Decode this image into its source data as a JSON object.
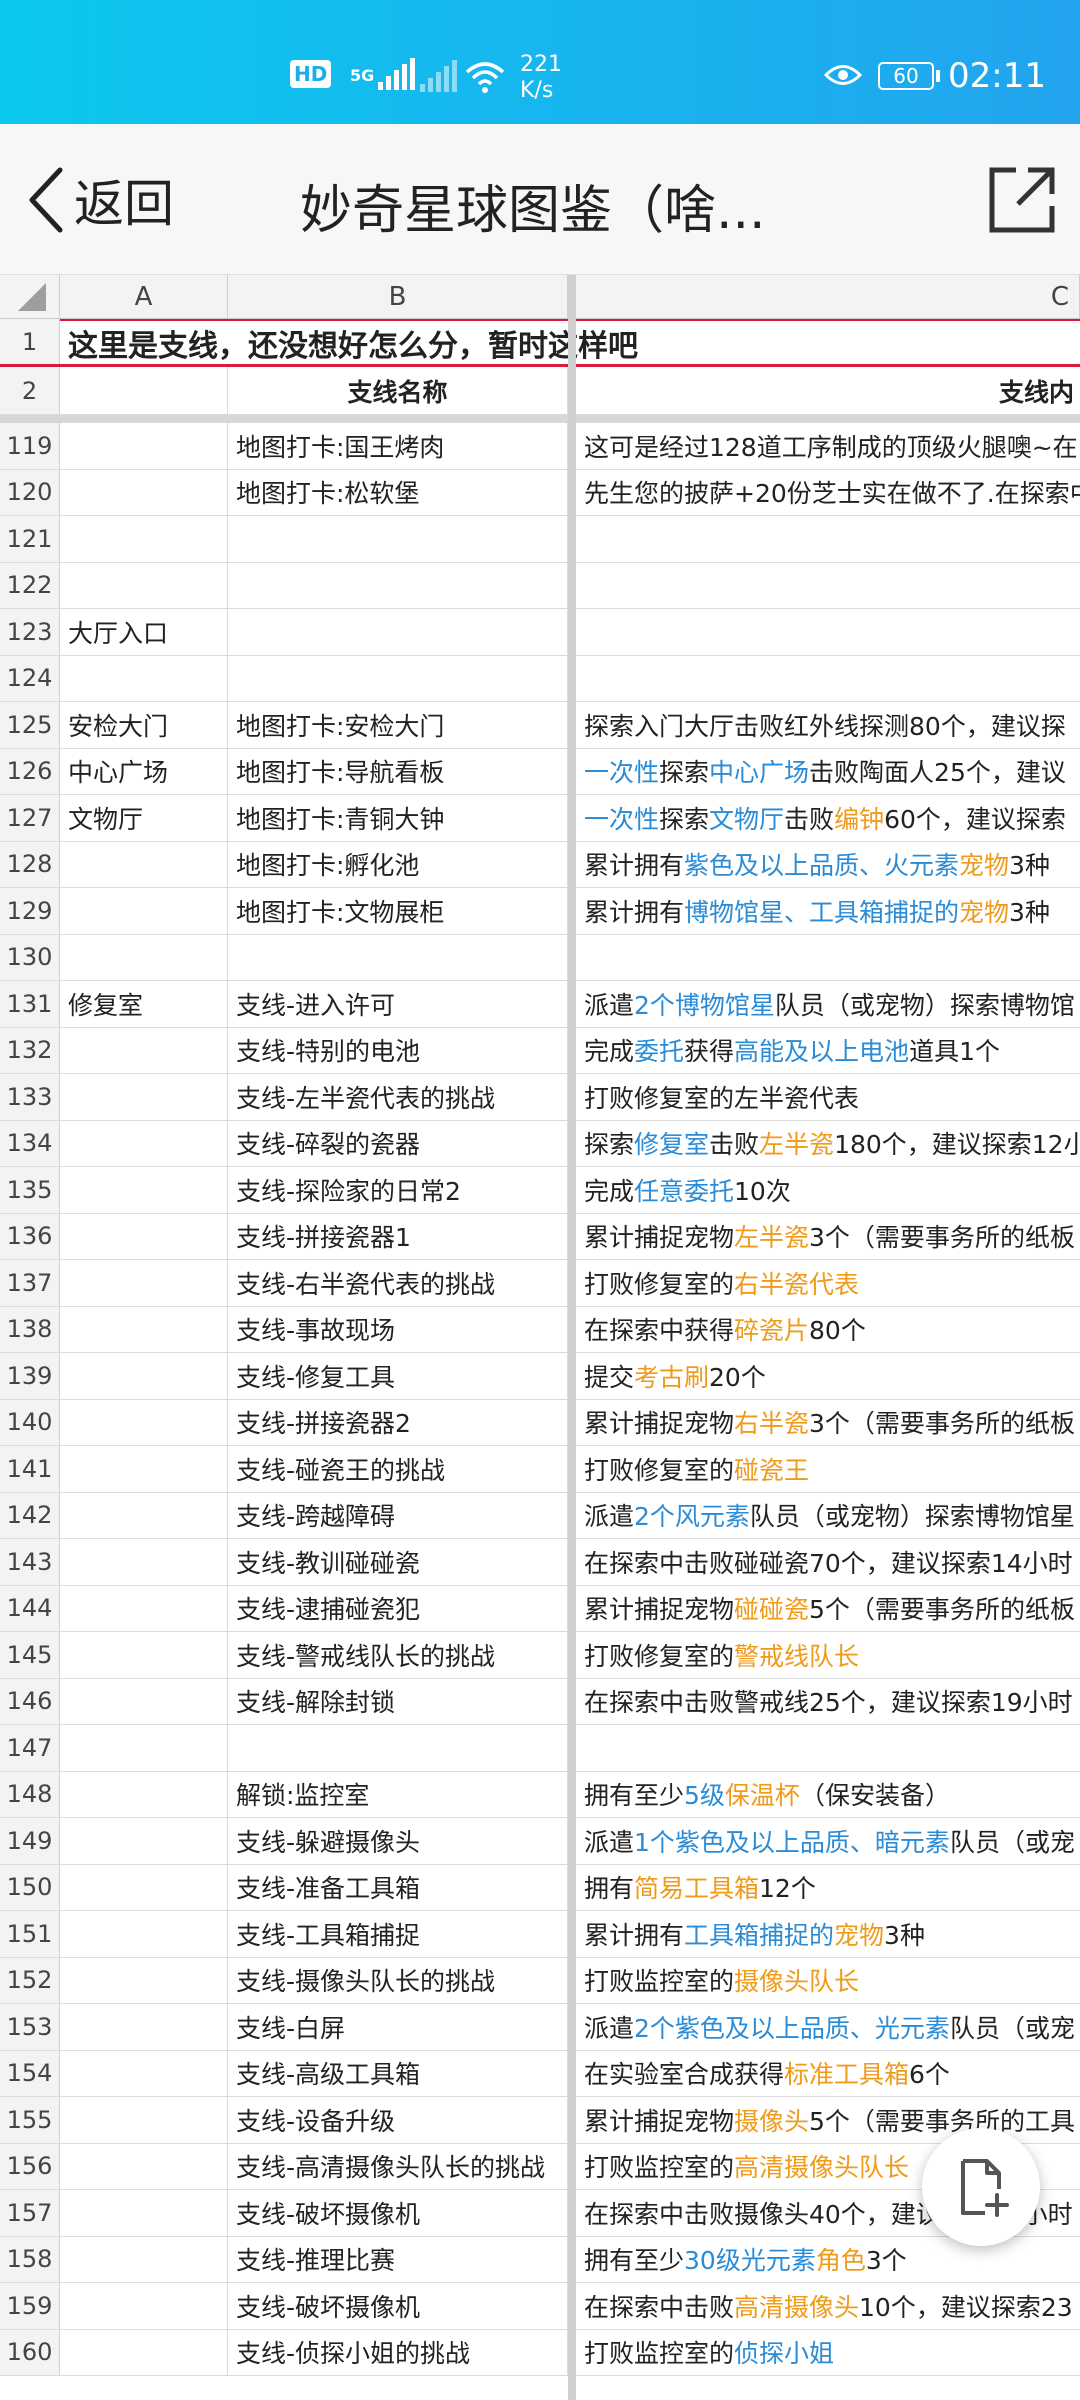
{
  "status": {
    "network_badge": "HD",
    "signal_label": "5G",
    "speed_value": "221",
    "speed_unit": "K/s",
    "battery": "60",
    "time": "02:11"
  },
  "appbar": {
    "back_label": "返回",
    "title": "妙奇星球图鉴（啥..."
  },
  "sheet": {
    "col_headers": [
      "A",
      "B",
      "C"
    ],
    "row1": {
      "num": "1",
      "text": "这里是支线，还没想好怎么分，暂时这样吧"
    },
    "row2": {
      "num": "2",
      "b": "支线名称",
      "c": "支线内"
    },
    "rows": [
      {
        "n": "119",
        "a": "",
        "b": "地图打卡:国王烤肉",
        "c": [
          {
            "t": "这可是经过128道工序制成的顶级火腿噢~在"
          }
        ]
      },
      {
        "n": "120",
        "a": "",
        "b": "地图打卡:松软堡",
        "c": [
          {
            "t": "先生您的披萨+20份芝士实在做不了.在探索中"
          }
        ]
      },
      {
        "n": "121",
        "a": "",
        "b": "",
        "c": []
      },
      {
        "n": "122",
        "a": "",
        "b": "",
        "c": []
      },
      {
        "n": "123",
        "a": "大厅入口",
        "b": "",
        "c": []
      },
      {
        "n": "124",
        "a": "",
        "b": "",
        "c": []
      },
      {
        "n": "125",
        "a": "安检大门",
        "b": "地图打卡:安检大门",
        "c": [
          {
            "t": "探索入门大厅击败红外线探测80个，建议探"
          }
        ]
      },
      {
        "n": "126",
        "a": "中心广场",
        "b": "地图打卡:导航看板",
        "c": [
          {
            "t": "一次性",
            "k": "blue"
          },
          {
            "t": "探索"
          },
          {
            "t": "中心广场",
            "k": "blue"
          },
          {
            "t": "击败陶面人25个，建议"
          }
        ]
      },
      {
        "n": "127",
        "a": "文物厅",
        "b": "地图打卡:青铜大钟",
        "c": [
          {
            "t": "一次性",
            "k": "blue"
          },
          {
            "t": "探索"
          },
          {
            "t": "文物厅",
            "k": "blue"
          },
          {
            "t": "击败"
          },
          {
            "t": "编钟",
            "k": "orange"
          },
          {
            "t": "60个，建议探索"
          }
        ]
      },
      {
        "n": "128",
        "a": "",
        "b": "地图打卡:孵化池",
        "c": [
          {
            "t": "累计拥有"
          },
          {
            "t": "紫色及以上品质、火元素",
            "k": "blue"
          },
          {
            "t": "宠物",
            "k": "orange"
          },
          {
            "t": "3种"
          }
        ]
      },
      {
        "n": "129",
        "a": "",
        "b": "地图打卡:文物展柜",
        "c": [
          {
            "t": "累计拥有"
          },
          {
            "t": "博物馆星、工具箱捕捉的",
            "k": "blue"
          },
          {
            "t": "宠物",
            "k": "orange"
          },
          {
            "t": "3种"
          }
        ]
      },
      {
        "n": "130",
        "a": "",
        "b": "",
        "c": []
      },
      {
        "n": "131",
        "a": "修复室",
        "b": "支线-进入许可",
        "c": [
          {
            "t": "派遣"
          },
          {
            "t": "2个博物馆星",
            "k": "blue"
          },
          {
            "t": "队员（或宠物）探索博物馆"
          }
        ]
      },
      {
        "n": "132",
        "a": "",
        "b": "支线-特别的电池",
        "c": [
          {
            "t": "完成"
          },
          {
            "t": "委托",
            "k": "blue"
          },
          {
            "t": "获得"
          },
          {
            "t": "高能及以上电池",
            "k": "blue"
          },
          {
            "t": "道具1个"
          }
        ]
      },
      {
        "n": "133",
        "a": "",
        "b": "支线-左半瓷代表的挑战",
        "c": [
          {
            "t": "打败修复室的左半瓷代表"
          }
        ]
      },
      {
        "n": "134",
        "a": "",
        "b": "支线-碎裂的瓷器",
        "c": [
          {
            "t": "探索"
          },
          {
            "t": "修复室",
            "k": "blue"
          },
          {
            "t": "击败"
          },
          {
            "t": "左半瓷",
            "k": "orange"
          },
          {
            "t": "180个，建议探索12小"
          }
        ]
      },
      {
        "n": "135",
        "a": "",
        "b": "支线-探险家的日常2",
        "c": [
          {
            "t": "完成"
          },
          {
            "t": "任意委托",
            "k": "blue"
          },
          {
            "t": "10次"
          }
        ]
      },
      {
        "n": "136",
        "a": "",
        "b": "支线-拼接瓷器1",
        "c": [
          {
            "t": "累计捕捉宠物"
          },
          {
            "t": "左半瓷",
            "k": "orange"
          },
          {
            "t": "3个（需要事务所的纸板"
          }
        ]
      },
      {
        "n": "137",
        "a": "",
        "b": "支线-右半瓷代表的挑战",
        "c": [
          {
            "t": "打败修复室的"
          },
          {
            "t": "右半瓷代表",
            "k": "orange"
          }
        ]
      },
      {
        "n": "138",
        "a": "",
        "b": "支线-事故现场",
        "c": [
          {
            "t": "在探索中获得"
          },
          {
            "t": "碎瓷片",
            "k": "orange"
          },
          {
            "t": "80个"
          }
        ]
      },
      {
        "n": "139",
        "a": "",
        "b": "支线-修复工具",
        "c": [
          {
            "t": "提交"
          },
          {
            "t": "考古刷",
            "k": "orange"
          },
          {
            "t": "20个"
          }
        ]
      },
      {
        "n": "140",
        "a": "",
        "b": "支线-拼接瓷器2",
        "c": [
          {
            "t": "累计捕捉宠物"
          },
          {
            "t": "右半瓷",
            "k": "orange"
          },
          {
            "t": "3个（需要事务所的纸板"
          }
        ]
      },
      {
        "n": "141",
        "a": "",
        "b": "支线-碰瓷王的挑战",
        "c": [
          {
            "t": "打败修复室的"
          },
          {
            "t": "碰瓷王",
            "k": "orange"
          }
        ]
      },
      {
        "n": "142",
        "a": "",
        "b": "支线-跨越障碍",
        "c": [
          {
            "t": "派遣"
          },
          {
            "t": "2个风元素",
            "k": "blue"
          },
          {
            "t": "队员（或宠物）探索博物馆星"
          }
        ]
      },
      {
        "n": "143",
        "a": "",
        "b": "支线-教训碰碰瓷",
        "c": [
          {
            "t": "在探索中击败碰碰瓷70个，建议探索14小时"
          }
        ]
      },
      {
        "n": "144",
        "a": "",
        "b": "支线-逮捕碰瓷犯",
        "c": [
          {
            "t": "累计捕捉宠物"
          },
          {
            "t": "碰碰瓷",
            "k": "orange"
          },
          {
            "t": "5个（需要事务所的纸板"
          }
        ]
      },
      {
        "n": "145",
        "a": "",
        "b": "支线-警戒线队长的挑战",
        "c": [
          {
            "t": "打败修复室的"
          },
          {
            "t": "警戒线队长",
            "k": "orange"
          }
        ]
      },
      {
        "n": "146",
        "a": "",
        "b": "支线-解除封锁",
        "c": [
          {
            "t": "在探索中击败警戒线25个，建议探索19小时"
          }
        ]
      },
      {
        "n": "147",
        "a": "",
        "b": "",
        "c": []
      },
      {
        "n": "148",
        "a": "",
        "b": "解锁:监控室",
        "c": [
          {
            "t": "拥有至少"
          },
          {
            "t": "5级",
            "k": "blue"
          },
          {
            "t": "保温杯",
            "k": "orange"
          },
          {
            "t": "（保安装备）"
          }
        ]
      },
      {
        "n": "149",
        "a": "",
        "b": "支线-躲避摄像头",
        "c": [
          {
            "t": "派遣"
          },
          {
            "t": "1个紫色及以上品质、暗元素",
            "k": "blue"
          },
          {
            "t": "队员（或宠"
          }
        ]
      },
      {
        "n": "150",
        "a": "",
        "b": "支线-准备工具箱",
        "c": [
          {
            "t": "拥有"
          },
          {
            "t": "简易工具箱",
            "k": "orange"
          },
          {
            "t": "12个"
          }
        ]
      },
      {
        "n": "151",
        "a": "",
        "b": "支线-工具箱捕捉",
        "c": [
          {
            "t": "累计拥有"
          },
          {
            "t": "工具箱捕捉的",
            "k": "blue"
          },
          {
            "t": "宠物",
            "k": "orange"
          },
          {
            "t": "3种"
          }
        ]
      },
      {
        "n": "152",
        "a": "",
        "b": "支线-摄像头队长的挑战",
        "c": [
          {
            "t": "打败监控室的"
          },
          {
            "t": "摄像头队长",
            "k": "orange"
          }
        ]
      },
      {
        "n": "153",
        "a": "",
        "b": "支线-白屏",
        "c": [
          {
            "t": "派遣"
          },
          {
            "t": "2个紫色及以上品质、光元素",
            "k": "blue"
          },
          {
            "t": "队员（或宠"
          }
        ]
      },
      {
        "n": "154",
        "a": "",
        "b": "支线-高级工具箱",
        "c": [
          {
            "t": "在实验室合成获得"
          },
          {
            "t": "标准工具箱",
            "k": "orange"
          },
          {
            "t": "6个"
          }
        ]
      },
      {
        "n": "155",
        "a": "",
        "b": "支线-设备升级",
        "c": [
          {
            "t": "累计捕捉宠物"
          },
          {
            "t": "摄像头",
            "k": "orange"
          },
          {
            "t": "5个（需要事务所的工具"
          }
        ]
      },
      {
        "n": "156",
        "a": "",
        "b": "支线-高清摄像头队长的挑战",
        "c": [
          {
            "t": "打败监控室的"
          },
          {
            "t": "高清摄像头队长",
            "k": "orange"
          }
        ]
      },
      {
        "n": "157",
        "a": "",
        "b": "支线-破坏摄像机",
        "c": [
          {
            "t": "在探索中击败摄像头40个，建议探索19小时"
          }
        ]
      },
      {
        "n": "158",
        "a": "",
        "b": "支线-推理比赛",
        "c": [
          {
            "t": "拥有至少"
          },
          {
            "t": "30级光元素",
            "k": "blue"
          },
          {
            "t": "角色",
            "k": "orange"
          },
          {
            "t": "3个"
          }
        ]
      },
      {
        "n": "159",
        "a": "",
        "b": "支线-破坏摄像机",
        "c": [
          {
            "t": "在探索中击败"
          },
          {
            "t": "高清摄像头",
            "k": "orange"
          },
          {
            "t": "10个，建议探索23"
          }
        ]
      },
      {
        "n": "160",
        "a": "",
        "b": "支线-侦探小姐的挑战",
        "c": [
          {
            "t": "打败监控室的"
          },
          {
            "t": "侦探小姐",
            "k": "blue"
          }
        ]
      }
    ]
  },
  "colors": {
    "blue": "#2a8bd6",
    "orange": "#f09a1a",
    "status_bar": "#15b6ef",
    "row1_border": "#d81b3c"
  },
  "icons": {
    "back": "chevron-left-icon",
    "share": "share-external-icon",
    "fab": "new-document-icon"
  }
}
